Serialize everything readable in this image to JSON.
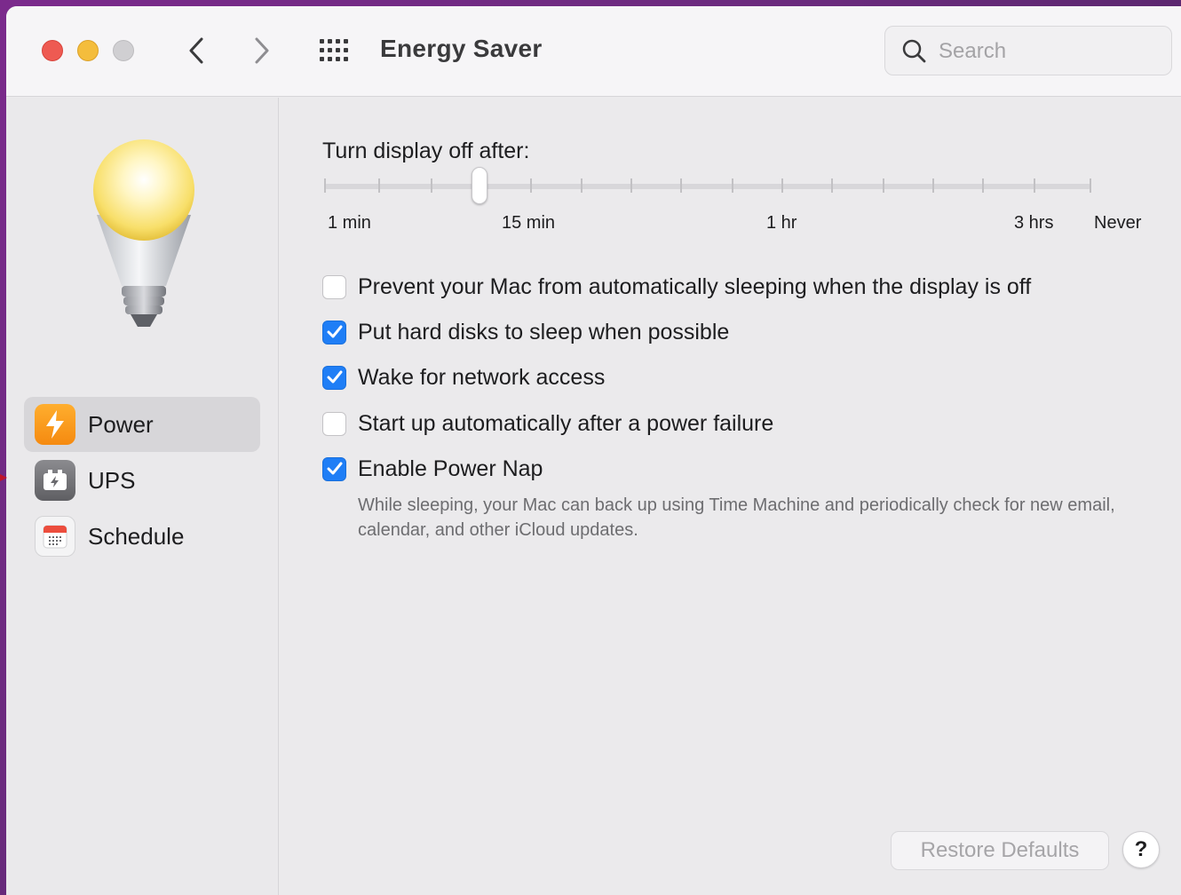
{
  "window": {
    "title": "Energy Saver"
  },
  "search": {
    "placeholder": "Search"
  },
  "sidebar": {
    "items": [
      {
        "label": "Power",
        "icon": "lightning-bolt-icon",
        "active": true
      },
      {
        "label": "UPS",
        "icon": "ups-battery-icon",
        "active": false
      },
      {
        "label": "Schedule",
        "icon": "calendar-icon",
        "active": false
      }
    ]
  },
  "display_sleep": {
    "title": "Turn display off after:",
    "tick_labels": [
      "1 min",
      "15 min",
      "1 hr",
      "3 hrs",
      "Never"
    ],
    "selected": "15 min"
  },
  "options": [
    {
      "label": "Prevent your Mac from automatically sleeping when the display is off",
      "checked": false
    },
    {
      "label": "Put hard disks to sleep when possible",
      "checked": true
    },
    {
      "label": "Wake for network access",
      "checked": true
    },
    {
      "label": "Start up automatically after a power failure",
      "checked": false
    },
    {
      "label": "Enable Power Nap",
      "checked": true
    }
  ],
  "power_nap_description": "While sleeping, your Mac can back up using Time Machine and periodically check for new email, calendar, and other iCloud updates.",
  "footer": {
    "restore_label": "Restore Defaults",
    "help_label": "?"
  },
  "colors": {
    "accent": "#1f7ef6",
    "power_icon": "#f58a10",
    "close": "#ee5a52",
    "minimize": "#f4bd3c"
  }
}
